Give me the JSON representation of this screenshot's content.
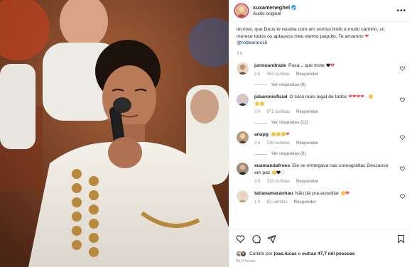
{
  "post": {
    "username": "xuxameneghel",
    "audio": "Áudio original",
    "caption_text": "incrível, que Deus te receba com um sorriso lindo e muito carinho, vc merece todos os aplausos meu eterno paquito. Te amamos ",
    "caption_mention": "@robbarros15",
    "caption_time": "3 h",
    "likes_prefix": "Curtido por ",
    "likes_user": "joao.lucas",
    "likes_mid": " e ",
    "likes_others": "outras 47,7 mil pessoas",
    "posted_ago": "há 3 horas"
  },
  "labels": {
    "reply": "Responder"
  },
  "comments": [
    {
      "user": "junnoandrade",
      "text": "Puxa... que triste ",
      "time": "3 h",
      "likes": "583 curtidas",
      "replies": "Ver respostas (6)"
    },
    {
      "user": "jubaronioficial",
      "text": "O cara mais legal de todos ",
      "time": "3 h",
      "likes": "871 curtidas",
      "replies": "Ver respostas (11)"
    },
    {
      "user": "anapg",
      "text": "",
      "time": "3 h",
      "likes": "239 curtidas",
      "replies": "Ver respostas (2)"
    },
    {
      "user": "euamandafroes",
      "text": "Ele se entregava nas coreografias  Descanse em paz ",
      "time": "3 h",
      "likes": "333 curtidas",
      "replies": ""
    },
    {
      "user": "tatianamaranhao",
      "text": "Não dá pra acreditar ",
      "time": "1 h",
      "likes": "82 curtidas",
      "replies": ""
    }
  ],
  "colors": {
    "verified": "#3897f0",
    "heart_red": "#ed4956",
    "link": "#00376b",
    "meta_gray": "#8e8e8e"
  },
  "icons": [
    "verified-icon",
    "more-options-icon",
    "heart-icon",
    "comment-icon",
    "share-icon",
    "bookmark-icon"
  ]
}
